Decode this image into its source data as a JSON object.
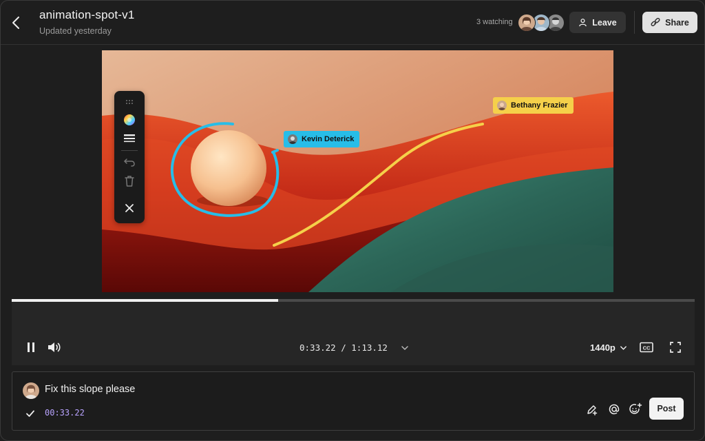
{
  "header": {
    "title": "animation-spot-v1",
    "subtitle": "Updated yesterday",
    "watching": "3 watching",
    "leave_label": "Leave",
    "share_label": "Share"
  },
  "video": {
    "annotations": [
      {
        "author": "Kevin Deterick",
        "color": "#27bde8"
      },
      {
        "author": "Bethany Frazier",
        "color": "#f5d04a"
      }
    ],
    "toolbar": [
      "drag-handle-icon",
      "color-wheel-icon",
      "stroke-width-icon",
      "undo-icon",
      "trash-icon",
      "close-icon"
    ]
  },
  "player": {
    "progress_fraction": 0.39,
    "current_time": "0:33.22",
    "duration": "1:13.12",
    "quality": "1440p"
  },
  "comment": {
    "text": "Fix this slope please",
    "timestamp": "00:33.22",
    "post_label": "Post"
  },
  "colors": {
    "accent_timestamp": "#b9a4ff",
    "background": "#1e1e1e"
  }
}
